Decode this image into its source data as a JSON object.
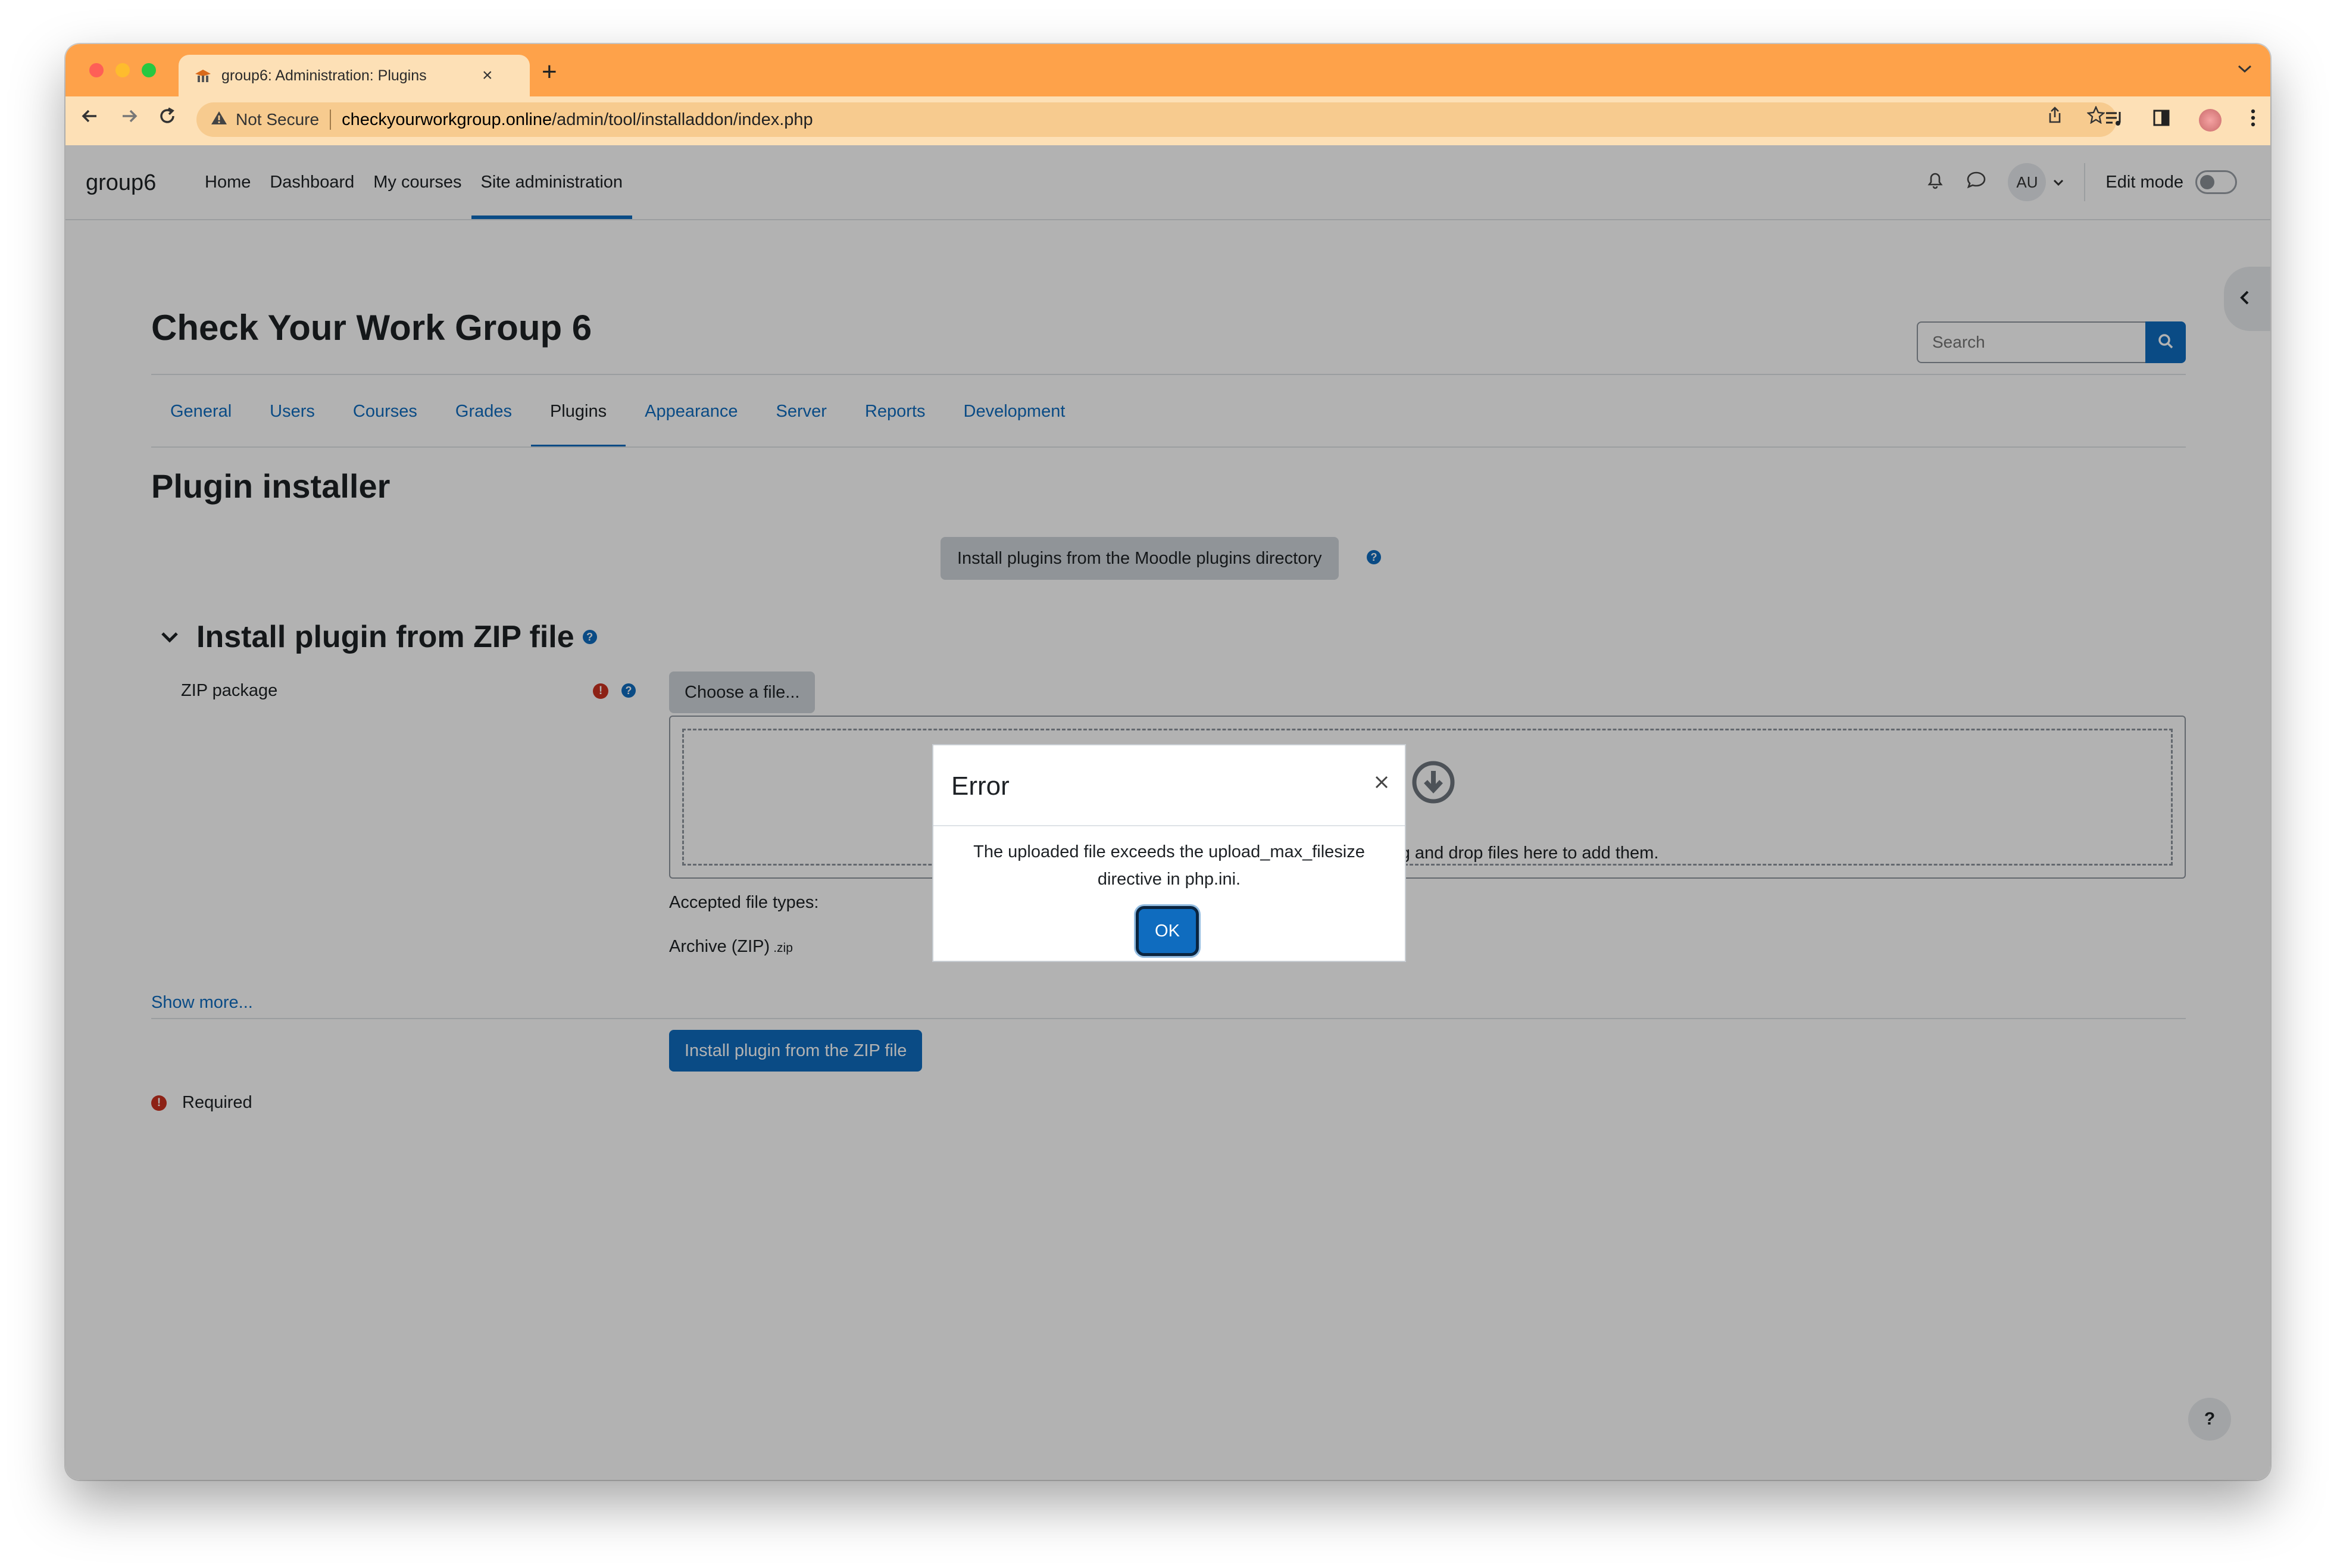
{
  "browser": {
    "tab_title": "group6: Administration: Plugins",
    "tab_close": "×",
    "new_tab": "+",
    "tabs_menu": "⌄",
    "security_label": "Not Secure",
    "url_host": "checkyourworkgroup.online",
    "url_path": "/admin/tool/installaddon/index.php"
  },
  "navbar": {
    "brand": "group6",
    "items": [
      "Home",
      "Dashboard",
      "My courses",
      "Site administration"
    ],
    "active": "Site administration",
    "user_initials": "AU",
    "edit_mode_label": "Edit mode"
  },
  "header": {
    "site_title": "Check Your Work Group 6",
    "search_placeholder": "Search"
  },
  "secondary_nav": {
    "items": [
      "General",
      "Users",
      "Courses",
      "Grades",
      "Plugins",
      "Appearance",
      "Server",
      "Reports",
      "Development"
    ],
    "active": "Plugins"
  },
  "main": {
    "heading": "Plugin installer",
    "directory_button": "Install plugins from the Moodle plugins directory",
    "zip_section_title": "Install plugin from ZIP file",
    "zip_label": "ZIP package",
    "choose_file": "Choose a file...",
    "dropzone_text": "You can drag and drop files here to add them.",
    "accepted_types": "Accepted file types:",
    "archive_name": "Archive (ZIP)",
    "archive_ext": ".zip",
    "show_more": "Show more...",
    "install_button": "Install plugin from the ZIP file",
    "required": "Required"
  },
  "modal": {
    "title": "Error",
    "close": "×",
    "message": "The uploaded file exceeds the upload_max_filesize directive in php.ini.",
    "ok": "OK"
  },
  "footer": {
    "help": "?"
  },
  "colors": {
    "tab_strip": "#fea24a",
    "toolbar": "#fde0b6",
    "primary": "#0f6cbf",
    "danger": "#ca3120"
  },
  "icons": [
    "back-arrow-icon",
    "forward-arrow-icon",
    "reload-icon",
    "warning-icon",
    "share-icon",
    "star-icon",
    "reading-list-icon",
    "side-panel-icon",
    "menu-dots-icon",
    "bell-icon",
    "chat-icon",
    "search-icon",
    "chevron-left-icon",
    "chevron-down-icon",
    "download-icon",
    "help-icon",
    "required-icon",
    "close-icon"
  ]
}
